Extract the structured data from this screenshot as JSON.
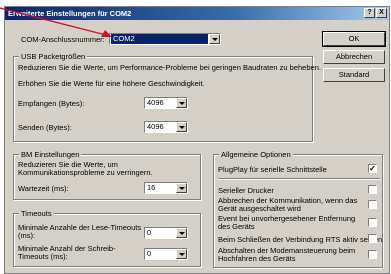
{
  "title": "Erweiterte Einstellungen für COM2",
  "title_buttons": [
    "?",
    "X"
  ],
  "com_port": {
    "label": "COM-Anschlussnummer:",
    "value": "COM2"
  },
  "buttons": {
    "ok": "OK",
    "cancel": "Abbrechen",
    "default": "Standard"
  },
  "usb": {
    "title": "USB Packetgrößen",
    "desc1": "Reduzieren Sie die Werte, um Performance-Probleme bei geringen Baudraten zu beheben.",
    "desc2": "Erhöhen Sie die Werte für eine höhere Geschwindigkeit.",
    "receive_label": "Empfangen (Bytes):",
    "receive_value": "4096",
    "send_label": "Senden (Bytes):",
    "send_value": "4096"
  },
  "bm": {
    "title": "BM Einstellungen",
    "desc": "Reduzieren Sie die Werte, um Kommunikationsprobleme zu verringern.",
    "latency_label": "Wartezeit (ms):",
    "latency_value": "16"
  },
  "timeouts": {
    "title": "Timeouts",
    "read_label": "Minimale Anzahle der Lese-Timeouts (ms):",
    "read_value": "0",
    "write_label": "Minimale Anzahl der Schreib-Timeouts (ms):",
    "write_value": "0"
  },
  "options": {
    "title": "Allgemeine Optionen",
    "items": [
      {
        "label": "PlugPlay für serielle Schnittstelle",
        "checked": true
      },
      {
        "label": "Serieller Drucker",
        "checked": false
      },
      {
        "label": "Abbrechen der Kommunikation, wenn das Gerät ausgeschaltet wird",
        "checked": false
      },
      {
        "label": "Event bei unvorhergesehener Entfernung des Geräts",
        "checked": false
      },
      {
        "label": "Beim Schließen der Verbindung RTS aktiv setzen",
        "checked": false
      },
      {
        "label": "Abschalten der Modemansteuerung beim Hochfahren des Geräts",
        "checked": false
      }
    ]
  },
  "colors": {
    "title_start": "#0a246a",
    "title_end": "#a6caf0",
    "dialog_bg": "#d4d0c8",
    "annotation": "#d0102a"
  }
}
